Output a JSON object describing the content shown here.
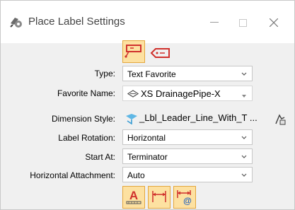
{
  "window": {
    "title": "Place Label Settings"
  },
  "fields": [
    {
      "label": "Type:",
      "value": "Text Favorite"
    },
    {
      "label": "Favorite Name:",
      "value": "XS DrainagePipe-X"
    },
    {
      "label": "Dimension Style:",
      "value": "_Lbl_Leader_Line_With_T ..."
    },
    {
      "label": "Label Rotation:",
      "value": "Horizontal"
    },
    {
      "label": "Start At:",
      "value": "Terminator"
    },
    {
      "label": "Horizontal Attachment:",
      "value": "Auto"
    }
  ],
  "colors": {
    "accent_active": "#fde1a1",
    "accent_border": "#e4a73c",
    "red_icon": "#d0312d",
    "window_bg": "#f0f0f0"
  },
  "icons": {
    "mode_leader": "leader-label-icon",
    "mode_tag": "tag-label-icon",
    "text_tool": "text-icon",
    "dim_tool": "dimension-icon",
    "dim_at_tool": "dimension-at-icon",
    "settings_side": "match-style-icon"
  }
}
